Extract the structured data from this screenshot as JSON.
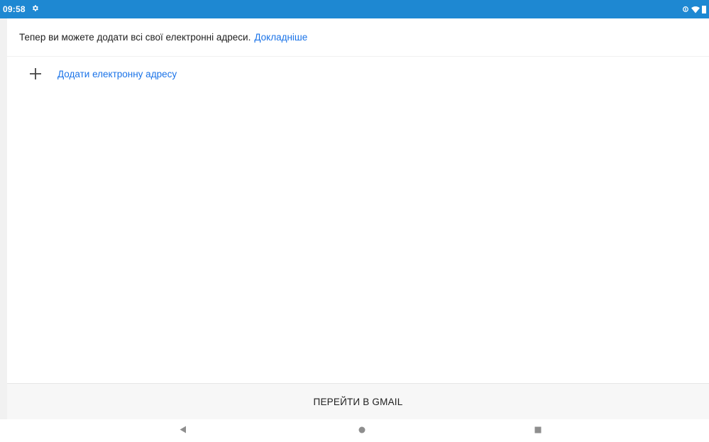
{
  "status_bar": {
    "time": "09:58",
    "left_icons": [
      "settings-icon"
    ],
    "right_icons": [
      "data-saver-icon",
      "wifi-icon",
      "battery-icon"
    ],
    "color": "#1e88d2"
  },
  "info": {
    "text": "Тепер ви можете додати всі свої електронні адреси.",
    "link": "Докладніше"
  },
  "add_email": {
    "icon": "plus-icon",
    "label": "Додати електронну адресу"
  },
  "bottom": {
    "button_label": "ПЕРЕЙТИ В GMAIL"
  },
  "nav_bar": {
    "buttons": [
      "back-icon",
      "home-icon",
      "recents-icon"
    ]
  },
  "colors": {
    "accent": "#1a73e8",
    "status_bar": "#1e88d2"
  }
}
